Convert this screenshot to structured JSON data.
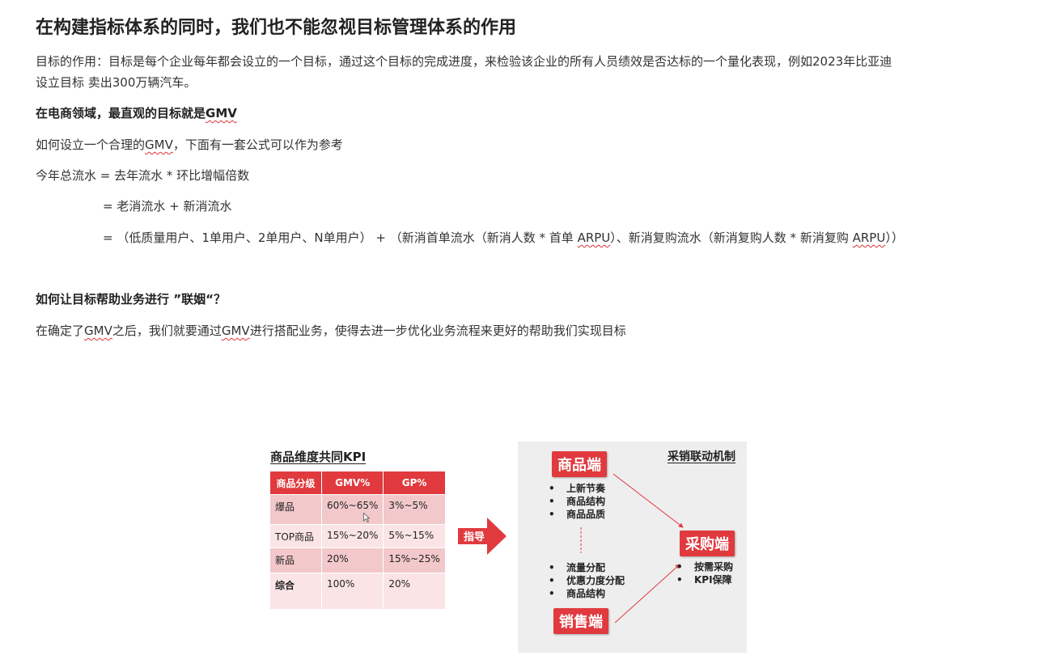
{
  "heading": "在构建指标体系的同时，我们也不能忽视目标管理体系的作用",
  "para_goal": {
    "line1": "目标的作用：目标是每个企业每年都会设立的一个目标，通过这个目标的完成进度，来检验该企业的所有人员绩效是否达标的一个量化表现，例如2023年比亚迪",
    "line2": "设立目标 卖出300万辆汽车。"
  },
  "gmv_heading": {
    "prefix": "在电商领域，最直观的目标就是",
    "term": "GMV"
  },
  "intro": {
    "a": "如何设立一个合理的",
    "term": "GMV",
    "b": "，下面有一套公式可以作为参考"
  },
  "formula": {
    "line1": "今年总流水 = 去年流水 * 环比增幅倍数",
    "line2": "= 老消流水 + 新消流水",
    "line3_a": "=   （低质量用户、1单用户、2单用户、N单用户）  +  （新消首单流水（新消人数 * 首单 ",
    "arpu1": "ARPU",
    "line3_b": "）、新消复购流水（新消复购人数 * 新消复购 ",
    "arpu2": "ARPU",
    "line3_c": "））"
  },
  "marriage_heading": "如何让目标帮助业务进行 ”联姻“？",
  "marriage_para": {
    "a": "在确定了",
    "t1": "GMV",
    "b": "之后，我们就要通过",
    "t2": "GMV",
    "c": "进行搭配业务，使得去进一步优化业务流程来更好的帮助我们实现目标"
  },
  "figure": {
    "kpi_title": "商品维度共同KPI",
    "kpi_table": {
      "headers": [
        "商品分级",
        "GMV%",
        "GP%"
      ],
      "rows": [
        [
          "爆品",
          "60%~65%",
          "3%~5%"
        ],
        [
          "TOP商品",
          "15%~20%",
          "5%~15%"
        ],
        [
          "新品",
          "20%",
          "15%~25%"
        ],
        [
          "综合",
          "100%",
          "20%"
        ]
      ]
    },
    "arrow_label": "指导",
    "mechanism": {
      "title": "采销联动机制",
      "product_box": "商品端",
      "product_items": [
        "上新节奏",
        "商品结构",
        "商品品质"
      ],
      "sales_items": [
        "流量分配",
        "优惠力度分配",
        "商品结构"
      ],
      "sales_box": "销售端",
      "purchase_box": "采购端",
      "purchase_items": [
        "按需采购",
        "KPI保障"
      ]
    },
    "accent_color": "#e03a3e"
  }
}
